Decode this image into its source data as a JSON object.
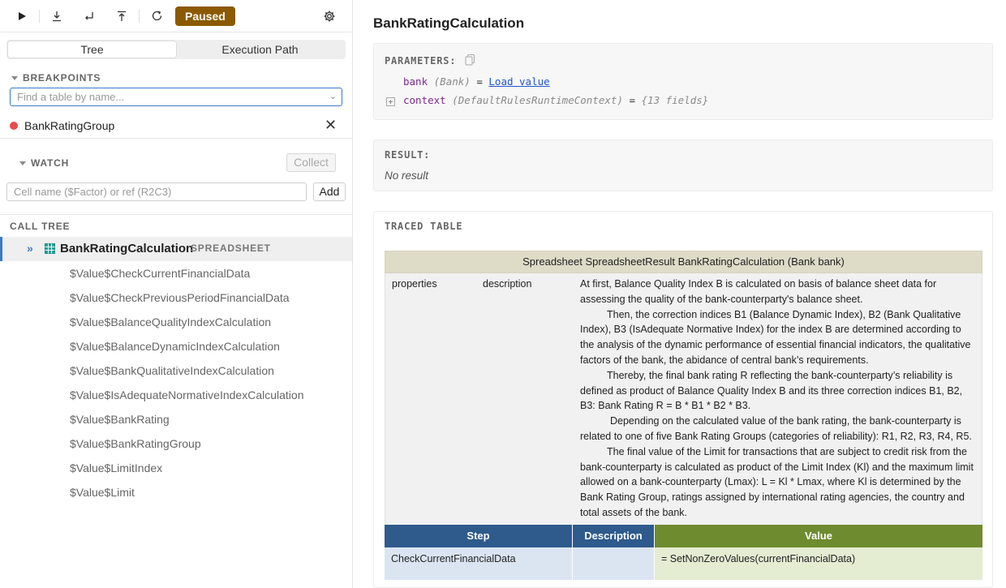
{
  "toolbar": {
    "status": "Paused"
  },
  "view_tabs": [
    "Tree",
    "Execution Path"
  ],
  "breakpoints": {
    "heading": "BREAKPOINTS",
    "find_placeholder": "Find a table by name...",
    "items": [
      {
        "label": "BankRatingGroup",
        "color": "#e74c4c"
      }
    ]
  },
  "watch": {
    "heading": "WATCH",
    "collect_label": "Collect",
    "input_placeholder": "Cell name ($Factor) or ref (R2C3)",
    "add_label": "Add"
  },
  "call_tree": {
    "heading": "CALL TREE",
    "root": {
      "label": "BankRatingCalculation",
      "type": "SPREADSHEET"
    },
    "children": [
      "$Value$CheckCurrentFinancialData",
      "$Value$CheckPreviousPeriodFinancialData",
      "$Value$BalanceQualityIndexCalculation",
      "$Value$BalanceDynamicIndexCalculation",
      "$Value$BankQualitativeIndexCalculation",
      "$Value$IsAdequateNormativeIndexCalculation",
      "$Value$BankRating",
      "$Value$BankRatingGroup",
      "$Value$LimitIndex",
      "$Value$Limit"
    ]
  },
  "main": {
    "title": "BankRatingCalculation",
    "parameters": {
      "heading": "PARAMETERS:",
      "bank": {
        "name": "bank",
        "type": "(Bank)",
        "eq": "=",
        "value": "Load value"
      },
      "context": {
        "name": "context",
        "type": "(DefaultRulesRuntimeContext)",
        "eq": "=",
        "value": "{13 fields}"
      }
    },
    "result": {
      "heading": "RESULT:",
      "value": "No result"
    },
    "traced": {
      "heading": "TRACED TABLE",
      "table_header": "Spreadsheet SpreadsheetResult BankRatingCalculation (Bank bank)",
      "props_key": "properties",
      "props_field": "description",
      "description": [
        "At first, Balance Quality Index B is calculated on basis of balance sheet data for assessing the quality of the bank-counterparty's balance sheet.",
        "Then, the correction indices B1 (Balance Dynamic Index), B2 (Bank Qualitative Index), B3 (IsAdequate Normative Index) for the index B are determined according to the analysis of the dynamic performance of essential financial indicators, the qualitative factors of the bank, the abidance of central bank’s requirements.",
        "Thereby, the final bank rating R reflecting the bank-counterparty’s reliability is defined as product of Balance Quality Index B and its three correction indices B1, B2, B3: Bank Rating R = B * B1 * B2 * B3.",
        "Depending on the calculated value of the bank rating, the bank-counterparty is related to one of five Bank Rating Groups (categories of reliability): R1, R2, R3, R4, R5.",
        "The final value of the Limit for transactions that are subject to credit risk from the bank-counterparty is calculated as product of the Limit Index (Kl) and the maximum limit allowed on a bank-counterparty (Lmax): L = Kl * Lmax, where Kl is determined by the Bank Rating Group, ratings assigned by international rating agencies, the country and total assets of the bank."
      ],
      "columns": [
        "Step",
        "Description",
        "Value"
      ],
      "rows": [
        {
          "step": "CheckCurrentFinancialData",
          "description": "",
          "value": "= SetNonZeroValues(currentFinancialData)"
        }
      ],
      "colors": {
        "header_bg": "#2e5a8c",
        "value_header_bg": "#6e8b2f",
        "title_bg": "#dedbc7"
      }
    }
  }
}
